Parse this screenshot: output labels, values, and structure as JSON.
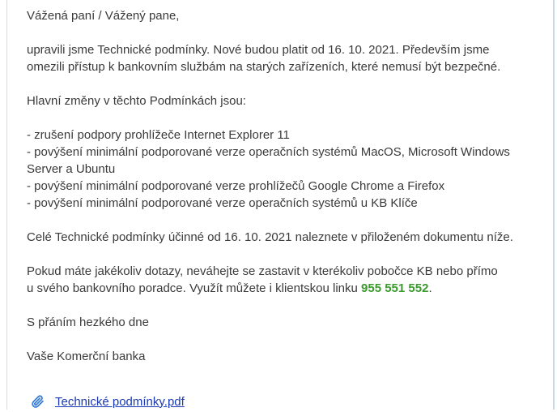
{
  "email": {
    "greeting": "Vážená paní / Vážený pane,",
    "intro_line1": "upravili jsme Technické podmínky. Nové budou platit od 16. 10. 2021. Především jsme",
    "intro_line2": "omezili přístup k bankovním službám na starých zařízeních, které nemusí být bezpečné.",
    "changes_heading": "Hlavní změny v těchto Podmínkách jsou:",
    "changes": [
      "- zrušení podpory prohlížeče Internet Explorer 11",
      "- povýšení minimální podporované verze operačních systémů MacOS, Microsoft Windows",
      "Server a Ubuntu",
      "- povýšení minimální podporované verze prohlížečů Google Chrome a Firefox",
      "- povýšení minimální podporované verze operačních systémů u KB Klíče"
    ],
    "full_terms": "Celé Technické podmínky účinné od 16. 10. 2021 naleznete v přiloženém dokumentu níže.",
    "contact_line1": "Pokud máte jakékoliv dotazy, neváhejte se zastavit v kterékoliv pobočce KB nebo přímo",
    "contact_line2_prefix": "u svého bankovního poradce. Využít můžete i  klientskou linku ",
    "phone": "955 551 552",
    "contact_line2_suffix": ".",
    "closing": "S přáním hezkého dne",
    "signature": "Vaše Komerční banka"
  },
  "attachment": {
    "icon": "paperclip-icon",
    "filename": "Technické podmínky.pdf",
    "icon_color": "#3b7fd4"
  },
  "colors": {
    "phone": "#3a9a2c",
    "link": "#1a39b3",
    "text": "#3a3a3a"
  }
}
